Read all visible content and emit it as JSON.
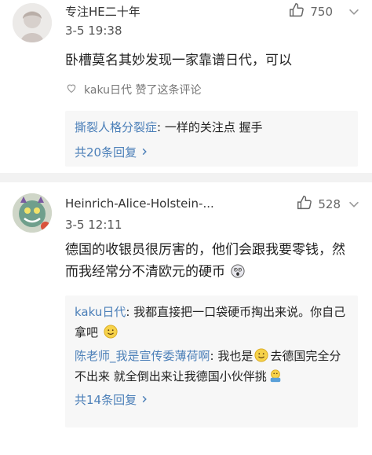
{
  "comments": [
    {
      "username": "专注HE二十年",
      "time": "3-5 19:38",
      "like_count": "750",
      "text": "卧槽莫名其妙发现一家靠谱日代，可以",
      "author_like": "kaku日代  赞了这条评论",
      "replies": [
        {
          "name": "撕裂人格分裂症",
          "text": ": 一样的关注点 握手"
        }
      ],
      "more_replies": "共20条回复"
    },
    {
      "username": "Heinrich-Alice-Holstein-...",
      "time": "3-5 12:11",
      "like_count": "528",
      "text": "德国的收银员很厉害的，他们会跟我要零钱，然而我经常分不清欧元的硬币",
      "replies": [
        {
          "name": "kaku日代",
          "text": ": 我都直接把一口袋硬币掏出来说。你自己拿吧"
        },
        {
          "name": "陈老师_我是宣传委薄荷啊",
          "text_before": ": 我也是",
          "text_after": "去德国完全分不出来 就全倒出来让我德国小伙伴挑"
        }
      ],
      "more_replies": "共14条回复"
    }
  ],
  "icons": {
    "like": "thumb-up-icon",
    "more": "chevron-down-icon",
    "author_like": "heart-icon",
    "more_replies": "chevron-right-icon"
  },
  "colors": {
    "link": "#4b7fb8",
    "reply_bg": "#f7f7f7",
    "divider": "#f2f2f2"
  }
}
